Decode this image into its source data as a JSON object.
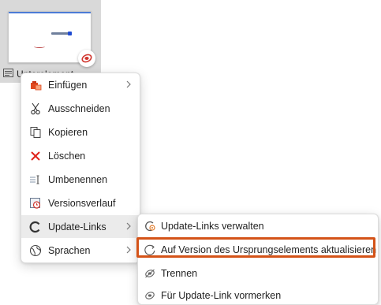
{
  "tile": {
    "label": "Unterelement"
  },
  "main_menu": {
    "items": [
      {
        "label": "Einfügen",
        "icon": "paste-icon",
        "submenu": true
      },
      {
        "label": "Ausschneiden",
        "icon": "scissors-icon",
        "submenu": false
      },
      {
        "label": "Kopieren",
        "icon": "copy-icon",
        "submenu": false
      },
      {
        "label": "Löschen",
        "icon": "delete-x-icon",
        "submenu": false
      },
      {
        "label": "Umbenennen",
        "icon": "rename-icon",
        "submenu": false
      },
      {
        "label": "Versionsverlauf",
        "icon": "version-history-icon",
        "submenu": false
      },
      {
        "label": "Update-Links",
        "icon": "update-links-icon",
        "submenu": true,
        "hover": true
      },
      {
        "label": "Sprachen",
        "icon": "globe-icon",
        "submenu": true
      }
    ]
  },
  "sub_menu": {
    "items": [
      {
        "label": "Update-Links verwalten",
        "icon": "manage-links-icon"
      },
      {
        "label": "Auf Version des Ursprungselements aktualisieren",
        "icon": "refresh-icon",
        "highlighted": true
      },
      {
        "label": "Trennen",
        "icon": "unlink-icon"
      },
      {
        "label": "Für Update-Link vormerken",
        "icon": "mark-link-icon"
      }
    ]
  },
  "colors": {
    "highlight_border": "#d45318",
    "hover_bg": "#ebebeb",
    "delete_red": "#e0241b",
    "badge_red": "#d0342c"
  }
}
